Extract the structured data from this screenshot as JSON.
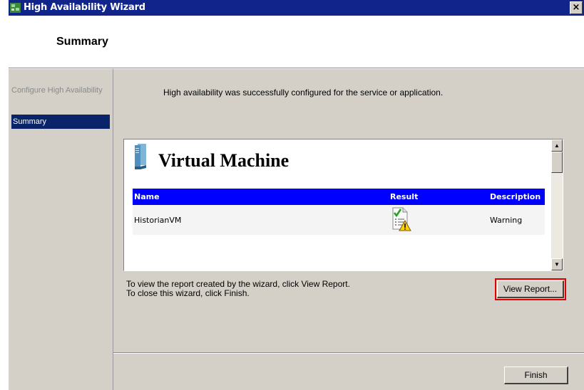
{
  "window": {
    "title": "High Availability Wizard",
    "close_glyph": "×"
  },
  "header": {
    "heading": "Summary"
  },
  "nav": {
    "items": [
      {
        "label": "Configure High Availability",
        "active": false
      },
      {
        "label": "Summary",
        "active": true
      }
    ]
  },
  "main": {
    "message": "High availability was successfully configured for the service or application.",
    "report": {
      "title": "Virtual Machine",
      "columns": [
        "Name",
        "Result",
        "Description"
      ],
      "rows": [
        {
          "name": "HistorianVM",
          "result_icon": "warning-report-icon",
          "description": "Warning"
        }
      ],
      "scroll_up": "▲",
      "scroll_down": "▼"
    },
    "instructions": [
      "To view the report created by the wizard, click View Report.",
      "To close this wizard, click Finish."
    ],
    "view_report_label": "View Report...",
    "finish_label": "Finish"
  },
  "colors": {
    "titlebar": "#10248c",
    "table_header": "#0000ff",
    "highlight_outline": "#e00000",
    "nav_active": "#0a246a"
  }
}
